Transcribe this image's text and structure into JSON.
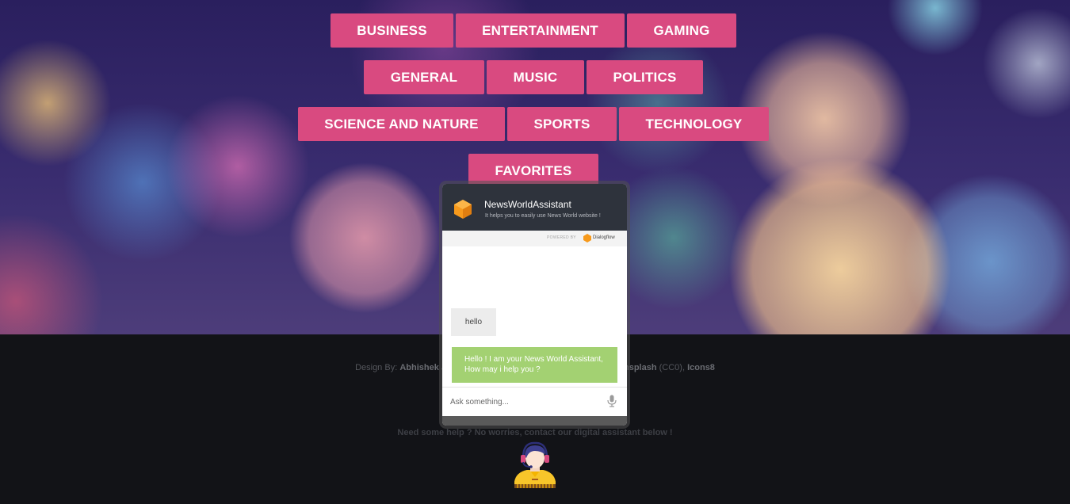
{
  "categories": {
    "row1": [
      "BUSINESS",
      "ENTERTAINMENT",
      "GAMING"
    ],
    "row2": [
      "GENERAL",
      "MUSIC",
      "POLITICS"
    ],
    "row3": [
      "SCIENCE AND NATURE",
      "SPORTS",
      "TECHNOLOGY"
    ],
    "row4": [
      "FAVORITES"
    ]
  },
  "colors": {
    "category_button": "#d94a80",
    "chat_header": "#2e333c",
    "bot_bubble": "#a3d172",
    "user_bubble": "#ececec",
    "footer": "#121317"
  },
  "chat": {
    "title": "NewsWorldAssistant",
    "subtitle": "It helps you to easily use News World website !",
    "powered_by": "POWERED BY",
    "provider": "Dialogflow",
    "messages": [
      {
        "from": "user",
        "text": "hello"
      },
      {
        "from": "bot",
        "text": "Hello ! I am your News World Assistant, How may i help you ?"
      }
    ],
    "input_placeholder": "Ask something...",
    "mic_icon": "microphone-icon",
    "logo_icon": "dialogflow-cube-icon"
  },
  "footer": {
    "credits_prefix": "Design By: ",
    "credits_name": "Abhishek J",
    "credits_suffix_pre": "nsplash",
    "credits_cc": " (CC0), ",
    "credits_icons": "Icons8",
    "help_text": "Need some help ? No worries, contact our digital assistant below !",
    "assistant_icon": "support-agent-icon"
  }
}
